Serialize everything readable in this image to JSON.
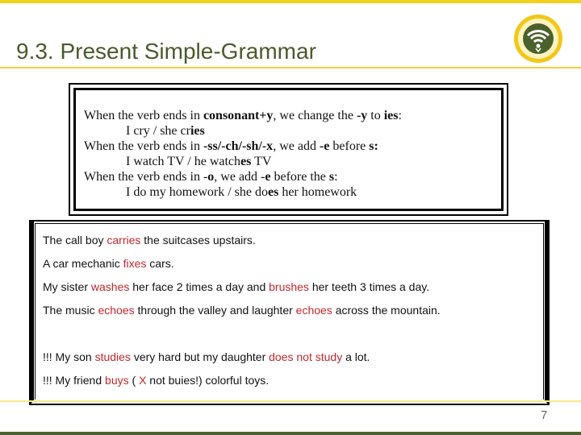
{
  "slide": {
    "title": "9.3. Present Simple-Grammar",
    "page_number": "7",
    "logo_icon": "university-seal-icon",
    "colors": {
      "title": "#4a5a2b",
      "accent_yellow": "#f2d01c",
      "footer_green": "#4b612b",
      "highlight_red": "#c0282d"
    }
  },
  "rules": {
    "r1": [
      "When the verb ends in ",
      "consonant+y",
      ", we change the ",
      "-y",
      " to ",
      "ies",
      ":"
    ],
    "e1": [
      "I cry / she cr",
      "ies"
    ],
    "r2": [
      "When the verb ends in ",
      "-ss/-ch/-sh/-x",
      ",  we add ",
      "-e",
      " before ",
      "s:"
    ],
    "e2": [
      "I watch TV / he watch",
      "es",
      " TV"
    ],
    "r3": [
      "When the verb ends in -",
      "o",
      ", we add -",
      "e",
      " before the ",
      "s",
      ":"
    ],
    "e3": [
      "I do my homework / she do",
      "es",
      " her homework"
    ]
  },
  "examples": [
    [
      "The call boy ",
      "carries",
      " the suitcases upstairs."
    ],
    [
      "A car mechanic ",
      "fixes",
      " cars."
    ],
    [
      "My sister ",
      "washes",
      " her face 2 times a day and ",
      "brushes",
      " her teeth 3 times a day."
    ],
    [
      "The music ",
      "echoes",
      " through the valley and laughter ",
      "echoes",
      " across the mountain."
    ],
    [
      "!!! My son ",
      "studies",
      " very hard but  my daughter ",
      "does not study",
      " a lot."
    ],
    [
      "!!! My friend ",
      "buys",
      " ( ",
      "X",
      " not buies!) colorful toys."
    ]
  ]
}
